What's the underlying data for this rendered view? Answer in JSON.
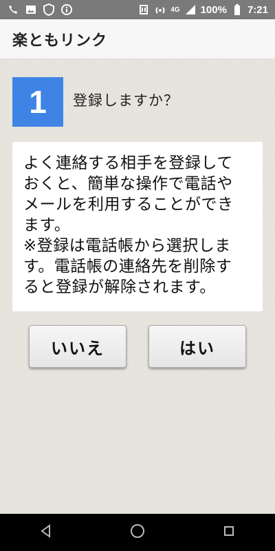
{
  "status_bar": {
    "network_type": "4G",
    "battery_percent": "100%",
    "time": "7:21",
    "left_icons": [
      "wifi-calling-icon",
      "image-icon",
      "shield-icon",
      "info-icon"
    ],
    "right_icons": [
      "nfc-icon",
      "hotspot-icon",
      "signal-icon",
      "battery-icon"
    ]
  },
  "app_bar": {
    "title": "楽ともリンク"
  },
  "step": {
    "number": "1",
    "question": "登録しますか？"
  },
  "message": {
    "lines": [
      "よく連絡する相手を登録して",
      "おくと、簡単な操作で電話や",
      "メールを利用することができ",
      "ます。",
      "※登録は電話帳から選択しま",
      "す。電話帳の連絡先を削除す",
      "ると登録が解除されます。"
    ]
  },
  "buttons": {
    "no_label": "いいえ",
    "yes_label": "はい"
  },
  "nav_bar": {
    "icons": [
      "back-icon",
      "home-icon",
      "recents-icon"
    ]
  }
}
